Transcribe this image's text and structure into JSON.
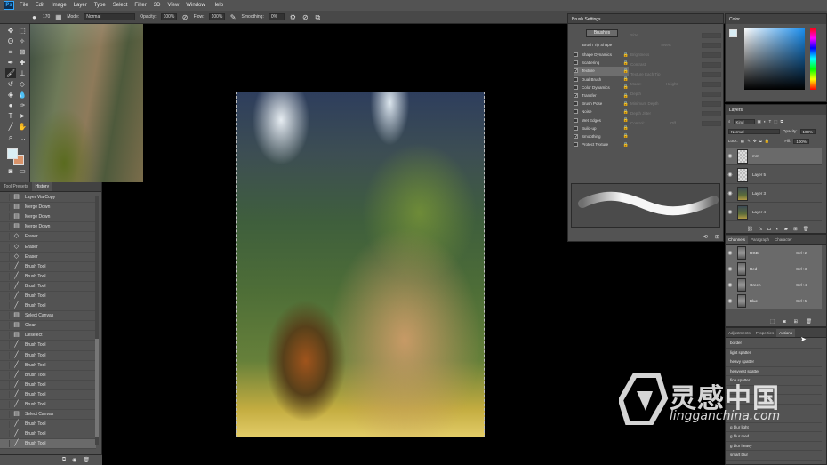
{
  "app": {
    "logo": "Ps",
    "menu": [
      "File",
      "Edit",
      "Image",
      "Layer",
      "Type",
      "Select",
      "Filter",
      "3D",
      "View",
      "Window",
      "Help"
    ]
  },
  "options_bar": {
    "brush_size": "170",
    "mode_label": "Mode:",
    "mode_value": "Normal",
    "opacity_label": "Opacity:",
    "opacity_value": "100%",
    "flow_label": "Flow:",
    "flow_value": "100%",
    "smoothing_label": "Smoothing:",
    "smoothing_value": "0%"
  },
  "history": {
    "tabs": [
      "Tool Presets",
      "History"
    ],
    "active_tab": "History",
    "items": [
      {
        "label": "Layer Via Copy",
        "icon": "layer-icon"
      },
      {
        "label": "Merge Down",
        "icon": "layer-icon"
      },
      {
        "label": "Merge Down",
        "icon": "layer-icon"
      },
      {
        "label": "Merge Down",
        "icon": "layer-icon"
      },
      {
        "label": "Eraser",
        "icon": "eraser-icon"
      },
      {
        "label": "Eraser",
        "icon": "eraser-icon"
      },
      {
        "label": "Eraser",
        "icon": "eraser-icon"
      },
      {
        "label": "Brush Tool",
        "icon": "brush-icon"
      },
      {
        "label": "Brush Tool",
        "icon": "brush-icon"
      },
      {
        "label": "Brush Tool",
        "icon": "brush-icon"
      },
      {
        "label": "Brush Tool",
        "icon": "brush-icon"
      },
      {
        "label": "Brush Tool",
        "icon": "brush-icon"
      },
      {
        "label": "Select Canvas",
        "icon": "layer-icon"
      },
      {
        "label": "Clear",
        "icon": "layer-icon"
      },
      {
        "label": "Deselect",
        "icon": "layer-icon"
      },
      {
        "label": "Brush Tool",
        "icon": "brush-icon"
      },
      {
        "label": "Brush Tool",
        "icon": "brush-icon"
      },
      {
        "label": "Brush Tool",
        "icon": "brush-icon"
      },
      {
        "label": "Brush Tool",
        "icon": "brush-icon"
      },
      {
        "label": "Brush Tool",
        "icon": "brush-icon"
      },
      {
        "label": "Brush Tool",
        "icon": "brush-icon"
      },
      {
        "label": "Brush Tool",
        "icon": "brush-icon"
      },
      {
        "label": "Select Canvas",
        "icon": "layer-icon"
      },
      {
        "label": "Brush Tool",
        "icon": "brush-icon"
      },
      {
        "label": "Brush Tool",
        "icon": "brush-icon"
      },
      {
        "label": "Brush Tool",
        "icon": "brush-icon"
      }
    ],
    "selected_index": 25
  },
  "brush_settings": {
    "title": "Brush Settings",
    "brushes_button": "Brushes",
    "tip_shape_label": "Brush Tip Shape",
    "options": [
      {
        "label": "Shape Dynamics",
        "checked": false,
        "highlight": false
      },
      {
        "label": "Scattering",
        "checked": false,
        "highlight": false
      },
      {
        "label": "Texture",
        "checked": true,
        "highlight": true
      },
      {
        "label": "Dual Brush",
        "checked": false,
        "highlight": false
      },
      {
        "label": "Color Dynamics",
        "checked": false,
        "highlight": false
      },
      {
        "label": "Transfer",
        "checked": true,
        "highlight": false
      },
      {
        "label": "Brush Pose",
        "checked": false,
        "highlight": false
      },
      {
        "label": "Noise",
        "checked": false,
        "highlight": false
      },
      {
        "label": "Wet Edges",
        "checked": false,
        "highlight": false
      },
      {
        "label": "Build-up",
        "checked": false,
        "highlight": false
      },
      {
        "label": "Smoothing",
        "checked": true,
        "highlight": false
      },
      {
        "label": "Protect Texture",
        "checked": false,
        "highlight": false
      }
    ],
    "controls": [
      {
        "label": "Size",
        "extra": "",
        "value": ""
      },
      {
        "label": "",
        "extra": "Invert",
        "value": ""
      },
      {
        "label": "Brightness",
        "extra": "",
        "value": ""
      },
      {
        "label": "Contrast",
        "extra": "",
        "value": ""
      },
      {
        "label": "Texture Each Tip",
        "extra": "",
        "value": ""
      },
      {
        "label": "Mode:",
        "extra": "Height",
        "value": ""
      },
      {
        "label": "Depth",
        "extra": "",
        "value": ""
      },
      {
        "label": "Minimum Depth",
        "extra": "",
        "value": ""
      },
      {
        "label": "Depth Jitter",
        "extra": "",
        "value": ""
      },
      {
        "label": "Control:",
        "extra": "Off",
        "value": ""
      }
    ]
  },
  "color_panel": {
    "title": "Color",
    "foreground": "#d9eef5",
    "background": "#d9936a"
  },
  "layers": {
    "tab": "Layers",
    "kind_label": "Kind",
    "blend_mode": "Normal",
    "opacity_label": "Opacity:",
    "opacity_value": "100%",
    "lock_label": "Lock:",
    "fill_label": "Fill:",
    "fill_value": "100%",
    "items": [
      {
        "name": "mm",
        "thumb": "transparent",
        "selected": true
      },
      {
        "name": "Layer 5",
        "thumb": "transparent",
        "selected": false
      },
      {
        "name": "Layer 3",
        "thumb": "art",
        "selected": false
      },
      {
        "name": "Layer 4",
        "thumb": "art",
        "selected": false
      }
    ]
  },
  "channels": {
    "tabs": [
      "Channels",
      "Paragraph",
      "Character"
    ],
    "active_tab": "Channels",
    "items": [
      {
        "name": "RGB",
        "shortcut": "Ctrl+2"
      },
      {
        "name": "Red",
        "shortcut": "Ctrl+3"
      },
      {
        "name": "Green",
        "shortcut": "Ctrl+4"
      },
      {
        "name": "Blue",
        "shortcut": "Ctrl+5"
      }
    ]
  },
  "actions": {
    "tabs": [
      "Adjustments",
      "Properties",
      "Actions"
    ],
    "active_tab": "Actions",
    "items": [
      "border",
      "light spatter",
      "heavy spatter",
      "heavyest spatter",
      "fine spatter",
      "",
      "",
      "",
      "",
      "g blur light",
      "g blur med",
      "g blur heavy",
      "smart blur"
    ]
  },
  "watermark": {
    "cn": "灵感中国",
    "en": "lingganchina.com"
  }
}
